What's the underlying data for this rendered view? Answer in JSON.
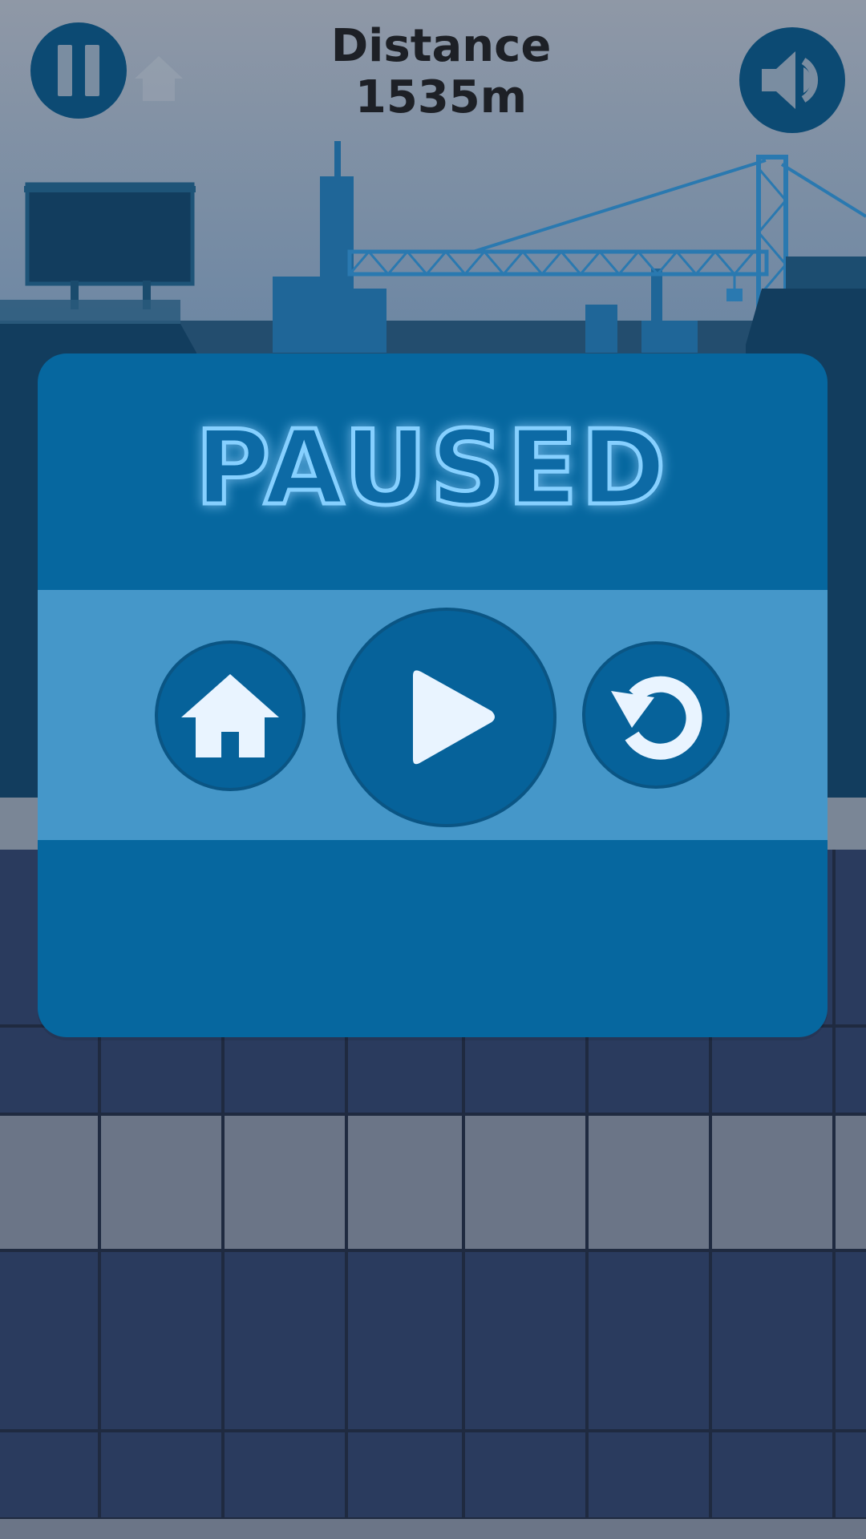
{
  "hud": {
    "distance_label": "Distance",
    "distance_value": "1535m",
    "pause_icon": "pause-icon",
    "sound_icon": "speaker-icon"
  },
  "pause_menu": {
    "title": "PAUSED",
    "buttons": {
      "home_icon": "home-icon",
      "resume_icon": "play-icon",
      "restart_icon": "restart-icon"
    }
  },
  "colors": {
    "panel": "#06679f",
    "band": "#4597c9",
    "button": "#06629a",
    "title_glow": "#86d0ff",
    "hud_button": "#0c4a73"
  }
}
